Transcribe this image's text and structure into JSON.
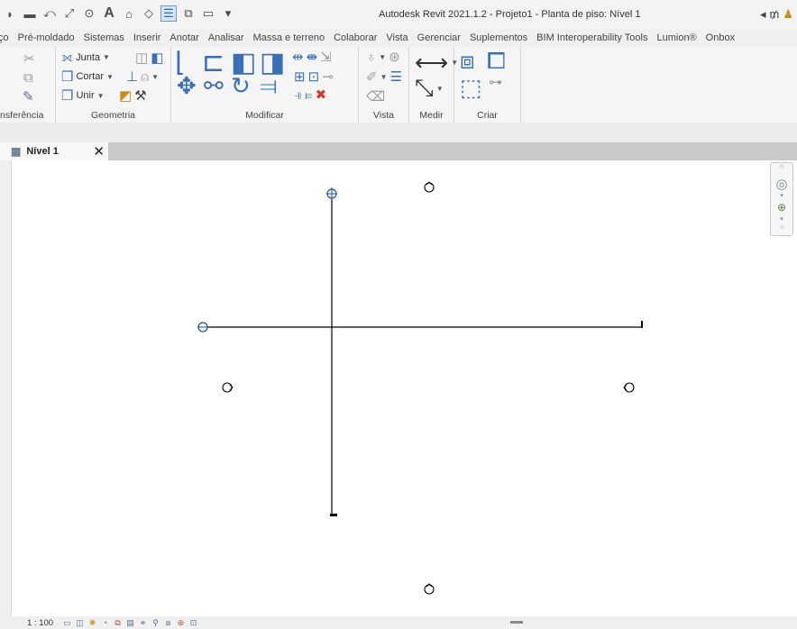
{
  "window": {
    "title": "Autodesk Revit 2021.1.2 - Projeto1 - Planta de piso: Nível 1"
  },
  "quick_access": {
    "icons": [
      "open-icon",
      "save-icon",
      "undo-icon",
      "measure-icon",
      "text-icon",
      "3d-view-icon",
      "section-icon",
      "thin-lines-icon",
      "close-hidden-icon",
      "switch-windows-icon",
      "customize-icon"
    ]
  },
  "ribbon_tabs": [
    "ço",
    "Pré-moldado",
    "Sistemas",
    "Inserir",
    "Anotar",
    "Analisar",
    "Massa e terreno",
    "Colaborar",
    "Vista",
    "Gerenciar",
    "Suplementos",
    "BIM Interoperability Tools",
    "Lumion®",
    "Onbox"
  ],
  "panels": {
    "transferencia": {
      "label": "nsferência"
    },
    "geometria": {
      "label": "Geometria",
      "junta": "Junta",
      "cortar": "Cortar",
      "unir": "Unir"
    },
    "modificar": {
      "label": "Modificar"
    },
    "vista": {
      "label": "Vista"
    },
    "medir": {
      "label": "Medir"
    },
    "criar": {
      "label": "Criar"
    }
  },
  "view_tab": {
    "label": "Nível 1",
    "close": "✕"
  },
  "status": {
    "scale": "1 : 100"
  },
  "colors": {
    "accent": "#2a67b8",
    "canvas": "#ffffff",
    "line": "#000000",
    "grid_bubble": "#1f4fa0"
  }
}
